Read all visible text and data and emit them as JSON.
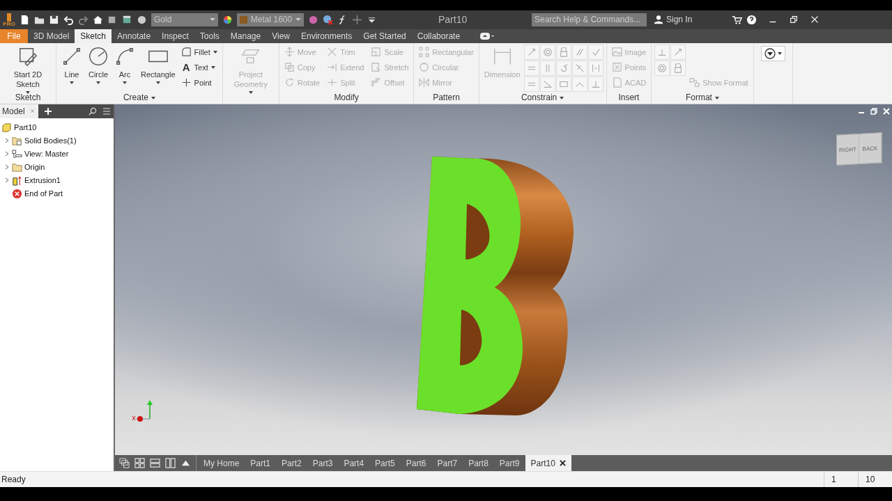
{
  "titlebar": {
    "logo_badge": "PRO",
    "material": "Gold",
    "appearance": "Metal 1600",
    "title": "Part10",
    "search": {
      "placeholder": "Search Help & Commands..."
    },
    "sign_in": "Sign In"
  },
  "tabs": [
    {
      "label": "File",
      "kind": "file",
      "selected": false
    },
    {
      "label": "3D Model",
      "kind": "tab",
      "selected": false
    },
    {
      "label": "Sketch",
      "kind": "tab",
      "selected": true
    },
    {
      "label": "Annotate",
      "kind": "tab",
      "selected": false
    },
    {
      "label": "Inspect",
      "kind": "tab",
      "selected": false
    },
    {
      "label": "Tools",
      "kind": "tab",
      "selected": false
    },
    {
      "label": "Manage",
      "kind": "tab",
      "selected": false
    },
    {
      "label": "View",
      "kind": "tab",
      "selected": false
    },
    {
      "label": "Environments",
      "kind": "tab",
      "selected": false
    },
    {
      "label": "Get Started",
      "kind": "tab",
      "selected": false
    },
    {
      "label": "Collaborate",
      "kind": "tab",
      "selected": false
    }
  ],
  "ribbon": [
    {
      "title": "Sketch",
      "menu": false,
      "tools": [
        {
          "kind": "large",
          "label": "Start 2D Sketch",
          "menu": true,
          "disabled": false
        }
      ]
    },
    {
      "title": "Create",
      "menu": true,
      "tools": [
        {
          "kind": "large",
          "label": "Line",
          "menu": true,
          "disabled": false
        },
        {
          "kind": "large",
          "label": "Circle",
          "menu": true,
          "disabled": false
        },
        {
          "kind": "large",
          "label": "Arc",
          "menu": true,
          "disabled": false
        },
        {
          "kind": "large",
          "label": "Rectangle",
          "menu": true,
          "disabled": false
        },
        {
          "kind": "small",
          "label": "Fillet",
          "menu": true,
          "disabled": false
        },
        {
          "kind": "small",
          "label": "Text",
          "glyph": "A",
          "menu": true,
          "disabled": false
        },
        {
          "kind": "small",
          "label": "Point",
          "menu": false,
          "disabled": false
        }
      ]
    },
    {
      "tools": [
        {
          "kind": "large",
          "label": "Project Geometry",
          "menu": true,
          "disabled": true
        }
      ]
    },
    {
      "title": "Modify",
      "menu": false,
      "tools": [
        {
          "kind": "small",
          "label": "Move",
          "menu": false,
          "disabled": true
        },
        {
          "kind": "small",
          "label": "Copy",
          "menu": false,
          "disabled": true
        },
        {
          "kind": "small",
          "label": "Rotate",
          "menu": false,
          "disabled": true
        },
        {
          "kind": "small",
          "label": "Trim",
          "menu": false,
          "disabled": true
        },
        {
          "kind": "small",
          "label": "Extend",
          "menu": false,
          "disabled": true
        },
        {
          "kind": "small",
          "label": "Split",
          "menu": false,
          "disabled": true
        },
        {
          "kind": "small",
          "label": "Scale",
          "menu": false,
          "disabled": true
        },
        {
          "kind": "small",
          "label": "Stretch",
          "menu": false,
          "disabled": true
        },
        {
          "kind": "small",
          "label": "Offset",
          "menu": false,
          "disabled": true
        }
      ]
    },
    {
      "title": "Pattern",
      "menu": false,
      "tools": [
        {
          "kind": "small",
          "label": "Rectangular",
          "menu": false,
          "disabled": true
        },
        {
          "kind": "small",
          "label": "Circular",
          "menu": false,
          "disabled": true
        },
        {
          "kind": "small",
          "label": "Mirror",
          "menu": false,
          "disabled": true
        }
      ]
    },
    {
      "title": "Constrain",
      "menu": true,
      "tools": [
        {
          "kind": "large",
          "label": "Dimension",
          "menu": false,
          "disabled": true
        },
        {
          "kind": "icon",
          "disabled": true
        },
        {
          "kind": "icon",
          "disabled": true
        },
        {
          "kind": "icon",
          "disabled": true
        },
        {
          "kind": "icon",
          "disabled": true
        },
        {
          "kind": "icon",
          "disabled": true
        },
        {
          "kind": "icon",
          "disabled": true
        },
        {
          "kind": "icon",
          "disabled": true
        },
        {
          "kind": "icon",
          "disabled": true
        },
        {
          "kind": "icon",
          "disabled": true
        },
        {
          "kind": "icon",
          "disabled": true
        },
        {
          "kind": "icon",
          "disabled": true
        },
        {
          "kind": "icon",
          "disabled": true
        },
        {
          "kind": "icon",
          "disabled": true
        },
        {
          "kind": "icon",
          "disabled": true
        },
        {
          "kind": "icon",
          "disabled": true
        }
      ]
    },
    {
      "title": "Insert",
      "menu": false,
      "tools": [
        {
          "kind": "small",
          "label": "Image",
          "menu": false,
          "disabled": true
        },
        {
          "kind": "small",
          "label": "Points",
          "menu": false,
          "disabled": true
        },
        {
          "kind": "small",
          "label": "ACAD",
          "menu": false,
          "disabled": true
        }
      ]
    },
    {
      "title": "Format",
      "menu": true,
      "tools": [
        {
          "kind": "icon",
          "disabled": true
        },
        {
          "kind": "icon",
          "disabled": true
        },
        {
          "kind": "icon",
          "disabled": true
        },
        {
          "kind": "icon",
          "disabled": true
        },
        {
          "kind": "wide",
          "label": "Show Format",
          "menu": false,
          "disabled": true
        }
      ]
    },
    {
      "tools": [
        {
          "kind": "dropdown",
          "disabled": false
        }
      ]
    }
  ],
  "browser": {
    "tab": "Model",
    "tree": [
      {
        "label": "Part10",
        "kind": "part",
        "expander": false,
        "children": [
          {
            "label": "Solid Bodies(1)",
            "kind": "bodies",
            "expander": true
          },
          {
            "label": "View: Master",
            "kind": "view",
            "expander": true
          },
          {
            "label": "Origin",
            "kind": "folder",
            "expander": true
          },
          {
            "label": "Extrusion1",
            "kind": "extrusion",
            "expander": true
          },
          {
            "label": "End of Part",
            "kind": "end",
            "expander": false
          }
        ]
      }
    ]
  },
  "viewcube": {
    "faces": [
      "RIGHT",
      "BACK"
    ]
  },
  "doc_tabs": [
    {
      "label": "My Home",
      "selected": false
    },
    {
      "label": "Part1",
      "selected": false
    },
    {
      "label": "Part2",
      "selected": false
    },
    {
      "label": "Part3",
      "selected": false
    },
    {
      "label": "Part4",
      "selected": false
    },
    {
      "label": "Part5",
      "selected": false
    },
    {
      "label": "Part6",
      "selected": false
    },
    {
      "label": "Part7",
      "selected": false
    },
    {
      "label": "Part8",
      "selected": false
    },
    {
      "label": "Part9",
      "selected": false
    },
    {
      "label": "Part10",
      "selected": true
    }
  ],
  "status_bar": {
    "text": "Ready",
    "cells": [
      "1",
      "10"
    ]
  }
}
